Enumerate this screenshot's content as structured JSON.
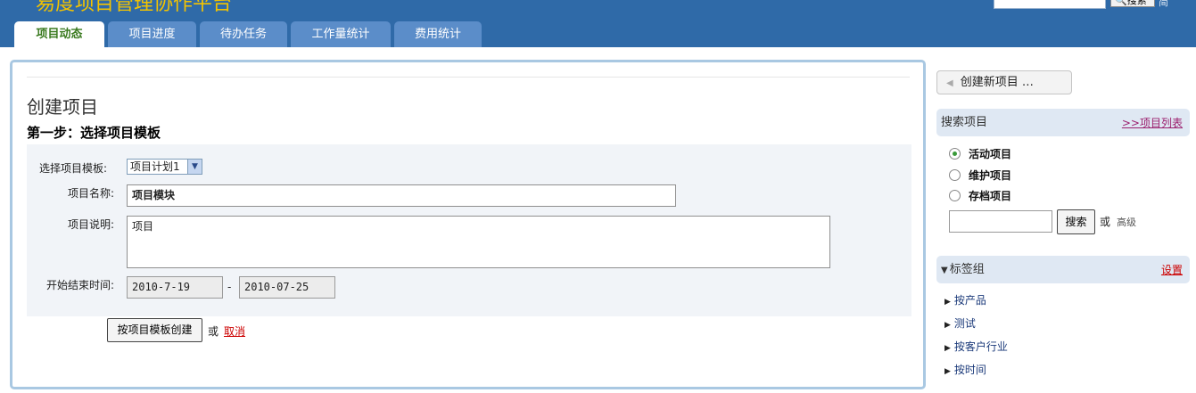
{
  "header": {
    "brand": "易度项目管理协作平台",
    "search_button": "搜索",
    "search_icon": "magnifier-icon",
    "top_link": "简",
    "tabs": [
      {
        "label": "项目动态",
        "active": true
      },
      {
        "label": "项目进度",
        "active": false
      },
      {
        "label": "待办任务",
        "active": false
      },
      {
        "label": "工作量统计",
        "active": false
      },
      {
        "label": "费用统计",
        "active": false
      }
    ]
  },
  "main": {
    "page_title": "创建项目",
    "step_title": "第一步：选择项目模板",
    "form": {
      "template_label": "选择项目模板:",
      "template_value": "项目计划1",
      "name_label": "项目名称:",
      "name_value": "项目模块",
      "desc_label": "项目说明:",
      "desc_value": "项目",
      "date_label": "开始结束时间:",
      "start_date": "2010-7-19",
      "date_separator": "-",
      "end_date": "2010-07-25"
    },
    "create_button": "按项目模板创建",
    "or_text": "或",
    "cancel_link": "取消"
  },
  "sidebar": {
    "create_button": "创建新项目 …",
    "search_header": "搜索项目",
    "project_list_link": ">>项目列表",
    "radios": [
      {
        "label": "活动项目",
        "checked": true
      },
      {
        "label": "维护项目",
        "checked": false
      },
      {
        "label": "存档项目",
        "checked": false
      }
    ],
    "search_button": "搜索",
    "or_text": "或",
    "advanced_link": "高级",
    "tags_header": "标签组",
    "tags_settings": "设置",
    "tags": [
      "按产品",
      "测试",
      "按客户行业",
      "按时间"
    ]
  },
  "colors": {
    "header_blue": "#2f6aa8",
    "active_tab_text": "#3a7a1f",
    "brand_yellow": "#f3c300",
    "cancel_red": "#cc0000"
  }
}
